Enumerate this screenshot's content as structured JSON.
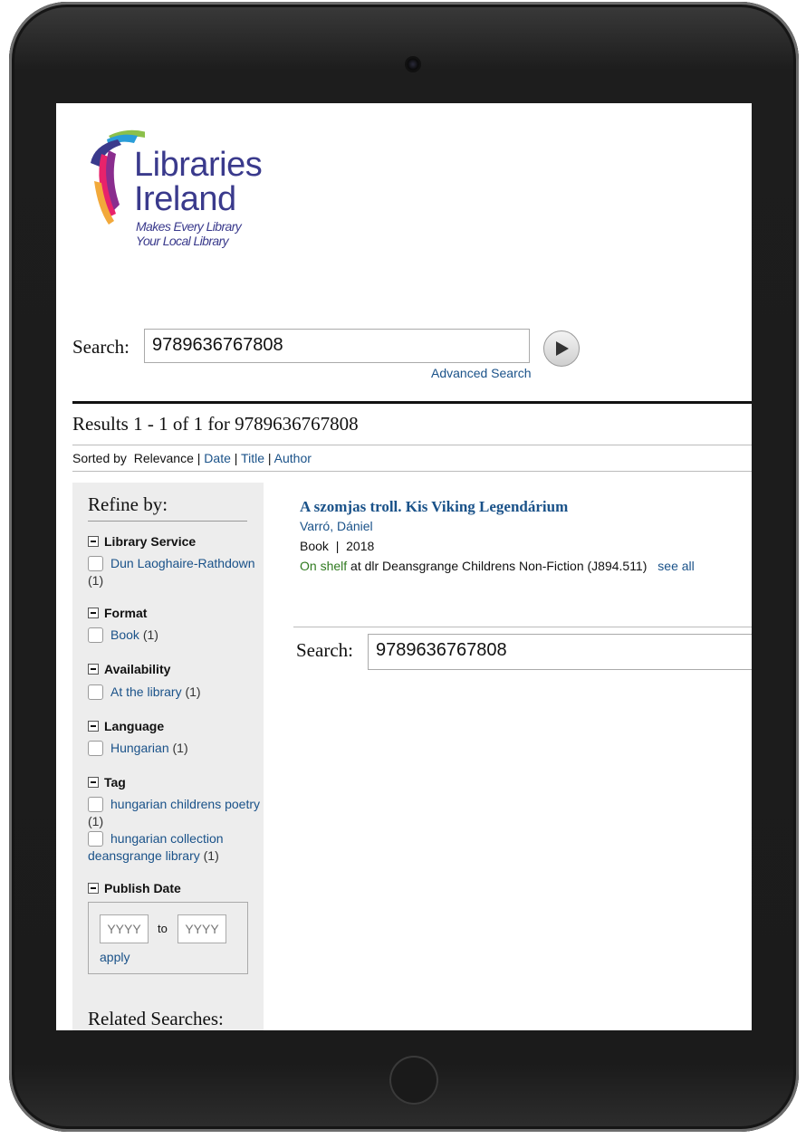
{
  "logo": {
    "line1": "Libraries",
    "line2": "Ireland",
    "tagline1": "Makes Every Library",
    "tagline2": "Your Local Library"
  },
  "search": {
    "label": "Search:",
    "value": "9789636767808",
    "advanced_link": "Advanced Search",
    "go_icon": "play-arrow-icon"
  },
  "results": {
    "title": "Results 1 - 1 of 1 for 9789636767808",
    "sort_label": "Sorted by",
    "sort_current": "Relevance",
    "sort_options": [
      "Date",
      "Title",
      "Author"
    ],
    "separator": "|"
  },
  "refine": {
    "title": "Refine by:",
    "facets": {
      "library_service": {
        "heading": "Library Service",
        "items": [
          {
            "label": "Dun Laoghaire-Rathdown",
            "count": "(1)"
          }
        ]
      },
      "format": {
        "heading": "Format",
        "items": [
          {
            "label": "Book",
            "count": "(1)"
          }
        ]
      },
      "availability": {
        "heading": "Availability",
        "items": [
          {
            "label": "At the library",
            "count": "(1)"
          }
        ]
      },
      "language": {
        "heading": "Language",
        "items": [
          {
            "label": "Hungarian",
            "count": "(1)"
          }
        ]
      },
      "tag": {
        "heading": "Tag",
        "items": [
          {
            "label": "hungarian childrens poetry",
            "count": "(1)"
          },
          {
            "label": "hungarian collection deansgrange library",
            "count": "(1)"
          }
        ]
      },
      "publish_date": {
        "heading": "Publish Date",
        "from_placeholder": "YYYY",
        "to_placeholder": "YYYY",
        "to_label": "to",
        "apply": "apply"
      }
    },
    "related_title": "Related Searches:"
  },
  "result_item": {
    "title": "A szomjas troll. Kis Viking Legendárium",
    "author": "Varró, Dániel",
    "format": "Book",
    "year": "2018",
    "status": "On shelf",
    "location": "at dlr Deansgrange Childrens Non-Fiction (J894.511)",
    "see_all": "see all"
  },
  "search_bottom": {
    "label": "Search:",
    "value": "9789636767808"
  },
  "colors": {
    "link": "#1a5289",
    "available": "#2f7a1f",
    "sidebar_bg": "#ededed",
    "brand": "#3a3a8c"
  }
}
